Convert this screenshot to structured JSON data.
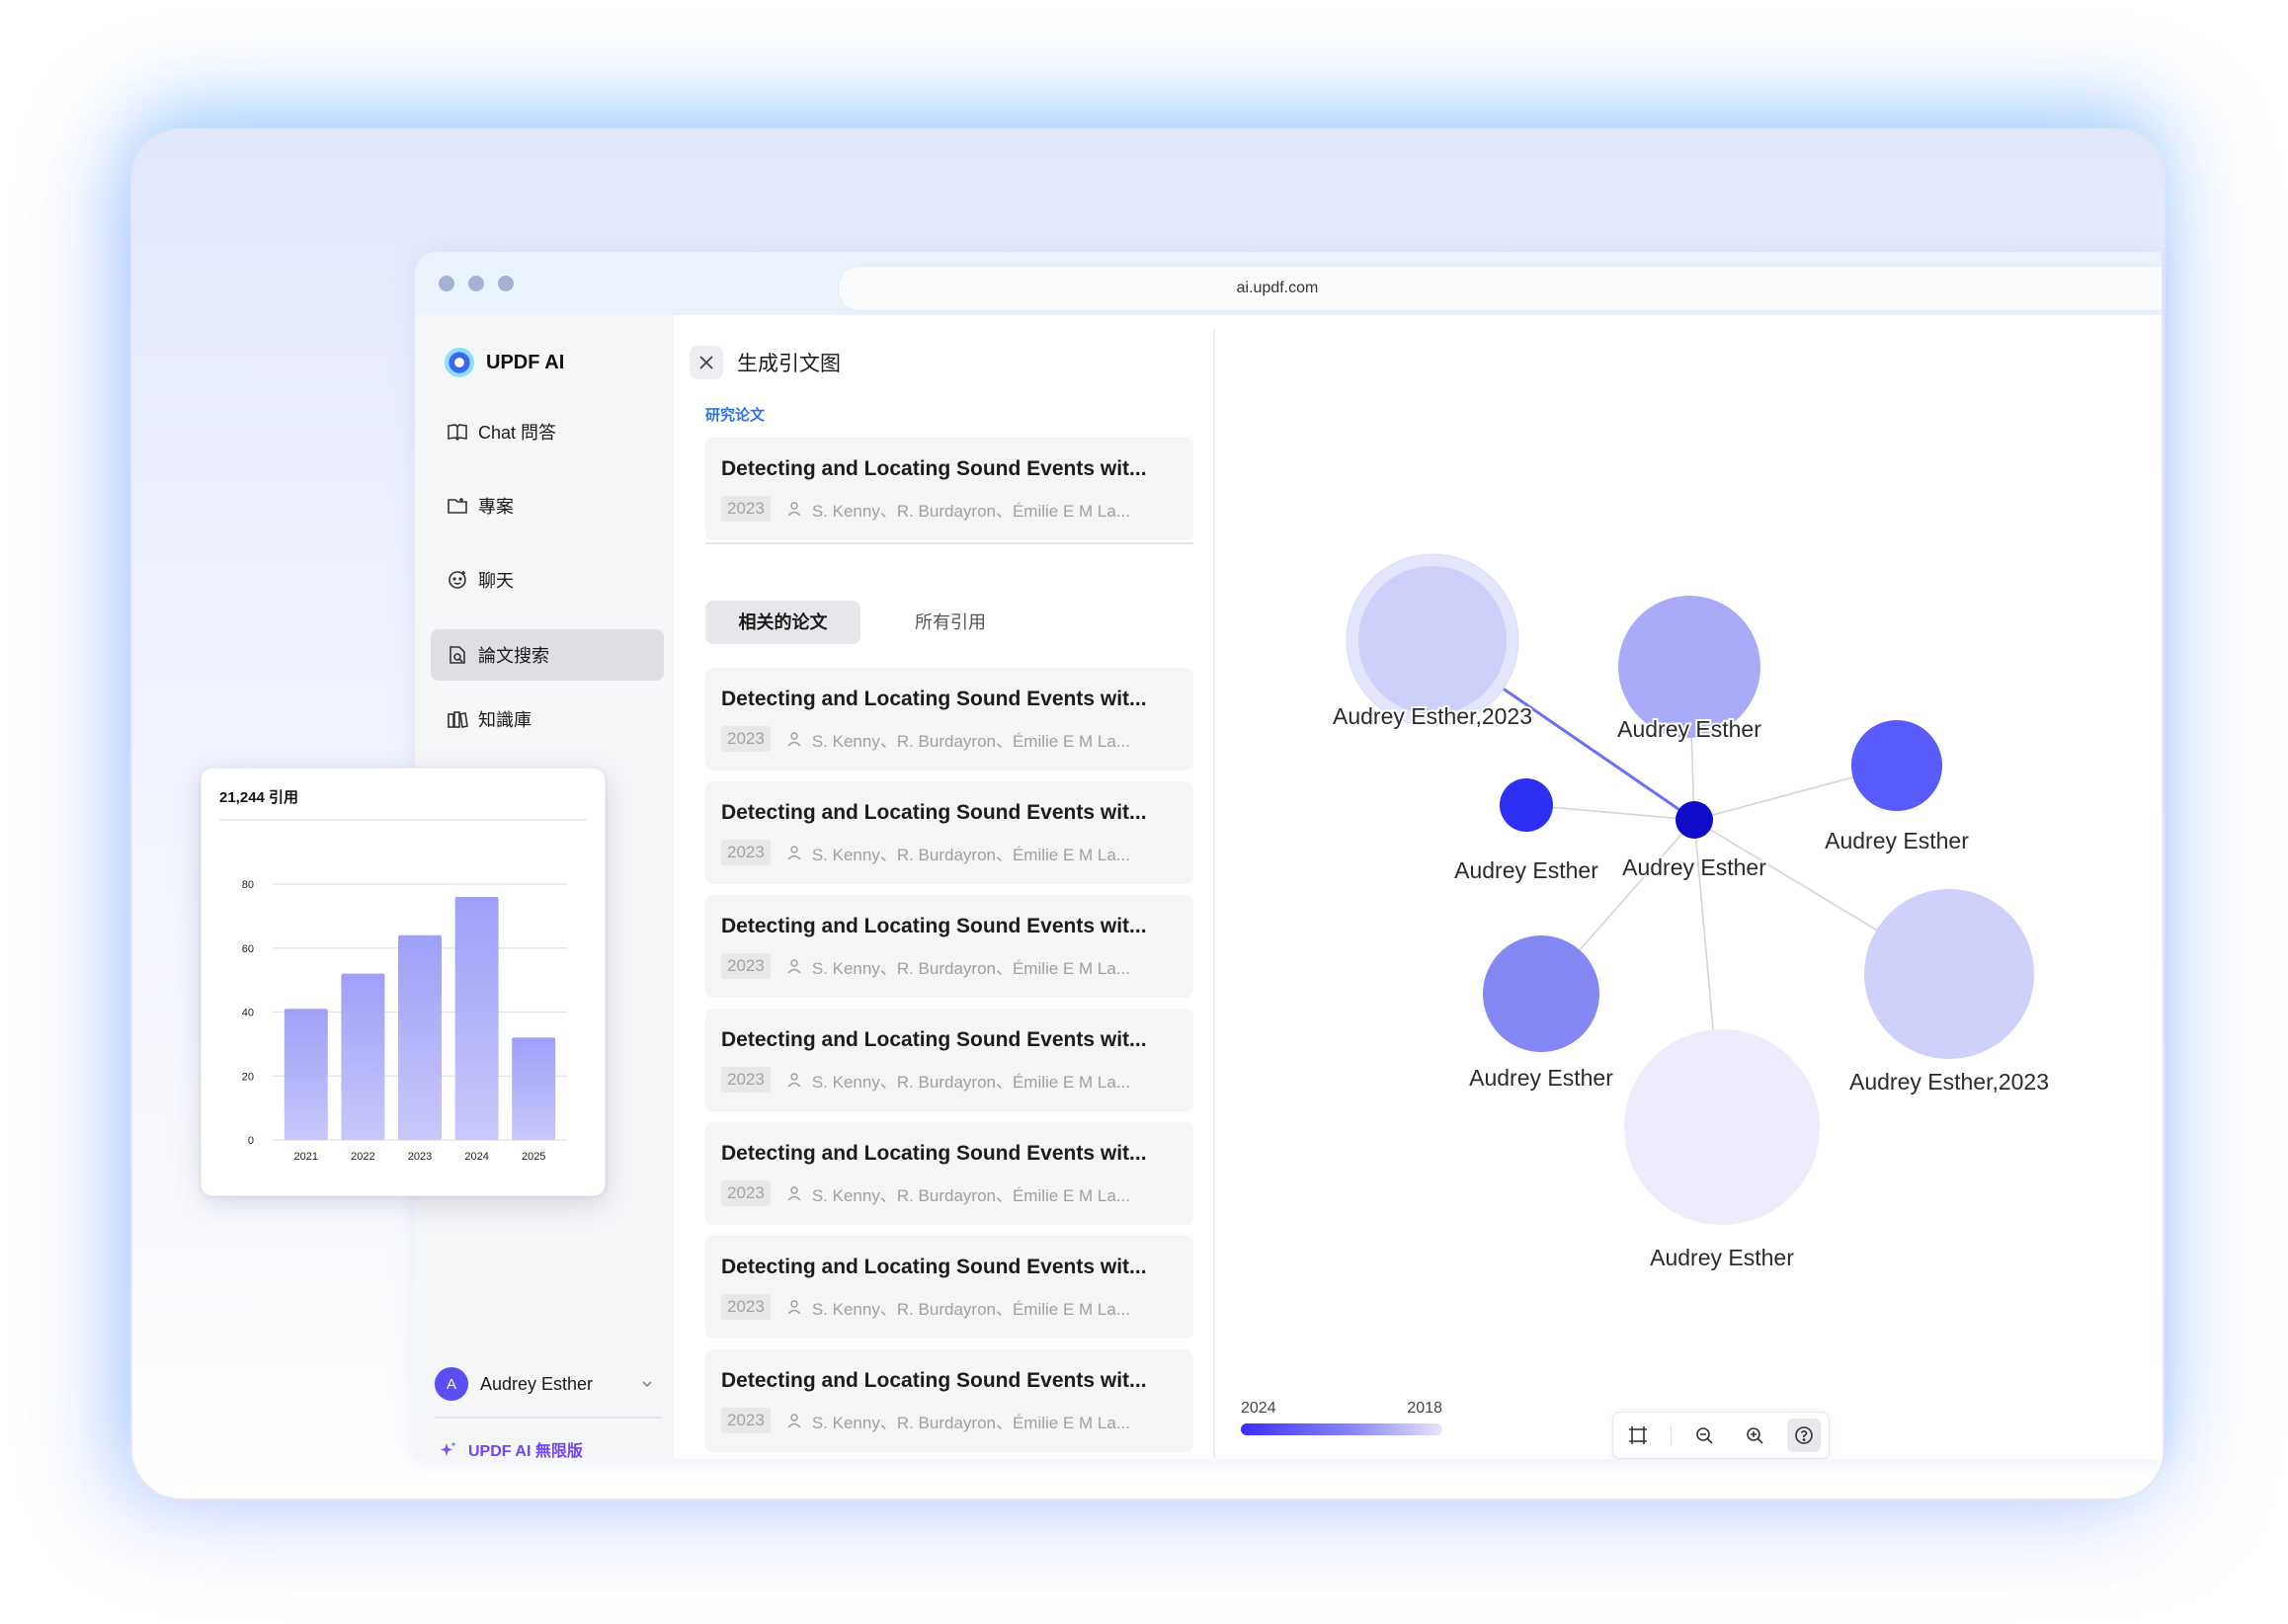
{
  "browser": {
    "url": "ai.updf.com"
  },
  "sidebar": {
    "logo_text": "UPDF AI",
    "items": [
      {
        "label": "Chat 問答",
        "icon": "chat-book-icon",
        "active": false
      },
      {
        "label": "專案",
        "icon": "folder-icon",
        "active": false
      },
      {
        "label": "聊天",
        "icon": "chat-bubble-icon",
        "active": false
      },
      {
        "label": "論文搜索",
        "icon": "paper-search-icon",
        "active": true
      },
      {
        "label": "知識庫",
        "icon": "library-icon",
        "active": false
      }
    ],
    "user": {
      "avatar_letter": "A",
      "name": "Audrey Esther"
    },
    "upgrade_label": "UPDF AI 無限版"
  },
  "panel": {
    "title": "生成引文图",
    "section_label": "研究论文",
    "main_paper": {
      "title": "Detecting and Locating Sound Events wit...",
      "year": "2023",
      "authors": "S. Kenny、R. Burdayron、Émilie E M La..."
    },
    "tabs": [
      {
        "label": "相关的论文",
        "active": true
      },
      {
        "label": "所有引用",
        "active": false
      }
    ],
    "related": [
      {
        "title": "Detecting and Locating Sound Events wit...",
        "year": "2023",
        "authors": "S. Kenny、R. Burdayron、Émilie E M La..."
      },
      {
        "title": "Detecting and Locating Sound Events wit...",
        "year": "2023",
        "authors": "S. Kenny、R. Burdayron、Émilie E M La..."
      },
      {
        "title": "Detecting and Locating Sound Events wit...",
        "year": "2023",
        "authors": "S. Kenny、R. Burdayron、Émilie E M La..."
      },
      {
        "title": "Detecting and Locating Sound Events wit...",
        "year": "2023",
        "authors": "S. Kenny、R. Burdayron、Émilie E M La..."
      },
      {
        "title": "Detecting and Locating Sound Events wit...",
        "year": "2023",
        "authors": "S. Kenny、R. Burdayron、Émilie E M La..."
      },
      {
        "title": "Detecting and Locating Sound Events wit...",
        "year": "2023",
        "authors": "S. Kenny、R. Burdayron、Émilie E M La..."
      },
      {
        "title": "Detecting and Locating Sound Events wit...",
        "year": "2023",
        "authors": "S. Kenny、R. Burdayron、Émilie E M La..."
      }
    ]
  },
  "graph": {
    "center_label": "Audrey Esther",
    "nodes": [
      {
        "label": "Audrey Esther,2023",
        "color": "#cdd0fb",
        "highlighted": true
      },
      {
        "label": "Audrey Esther",
        "color": "#a9abf8"
      },
      {
        "label": "Audrey Esther",
        "color": "#585cfb"
      },
      {
        "label": "Audrey Esther",
        "color": "#2d2ff2"
      },
      {
        "label": "Audrey Esther,2023",
        "color": "#cfd0fb"
      },
      {
        "label": "Audrey Esther",
        "color": "#8587f4"
      },
      {
        "label": "Audrey Esther",
        "color": "#ececfc"
      }
    ],
    "center_color": "#0f0bc9",
    "time_legend": {
      "start": "2024",
      "end": "2018"
    },
    "toolbar": [
      {
        "icon": "fit-frame-icon"
      },
      {
        "icon": "zoom-out-icon"
      },
      {
        "icon": "zoom-in-icon"
      },
      {
        "icon": "help-icon",
        "active": true
      }
    ]
  },
  "citation_card": {
    "title": "21,244 引用"
  },
  "chart_data": {
    "type": "bar",
    "title": "21,244 引用",
    "categories": [
      "2021",
      "2022",
      "2023",
      "2024",
      "2025"
    ],
    "values": [
      41,
      52,
      64,
      76,
      32
    ],
    "yticks": [
      0,
      20,
      40,
      60,
      80
    ],
    "ylim": [
      0,
      80
    ],
    "grid": true,
    "bar_color": "#9f9ff8"
  }
}
